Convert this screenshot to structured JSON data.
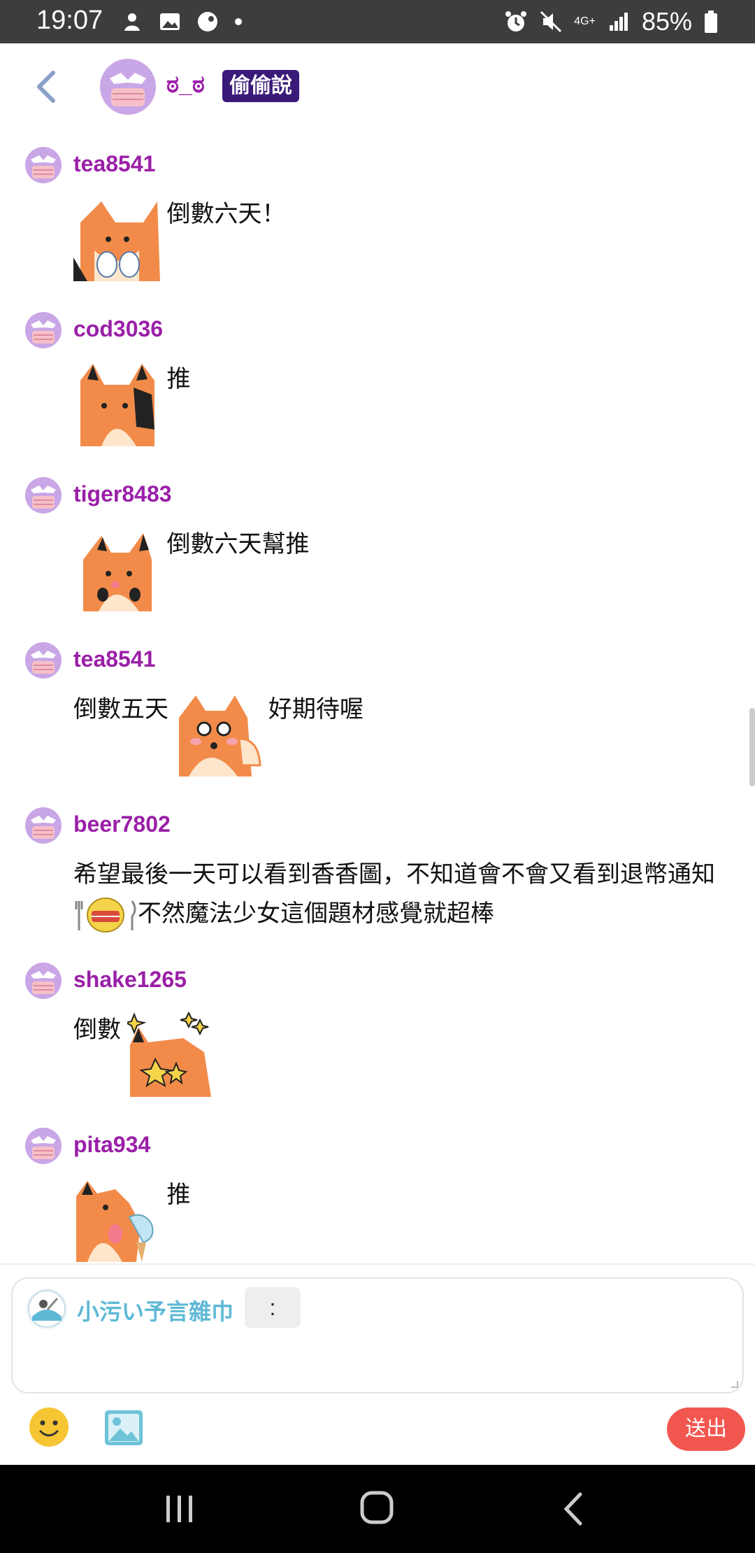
{
  "status_bar": {
    "time": "19:07",
    "battery": "85%",
    "network": "4G+",
    "left_icons": [
      "vpn-icon",
      "gallery-icon",
      "app-icon",
      "dot-icon"
    ],
    "right_icons": [
      "alarm-icon",
      "mute-icon",
      "signal-icon",
      "battery-icon"
    ]
  },
  "header": {
    "title": "ಠ_ಠ",
    "badge": "偷偷說"
  },
  "messages": [
    {
      "user": "tea8541",
      "parts": [
        {
          "type": "sticker",
          "icon": "fox-fist-sticker"
        },
        {
          "type": "text",
          "value": "倒數六天！"
        }
      ]
    },
    {
      "user": "cod3036",
      "parts": [
        {
          "type": "sticker",
          "icon": "fox-wave-sticker"
        },
        {
          "type": "text",
          "value": "推"
        }
      ]
    },
    {
      "user": "tiger8483",
      "parts": [
        {
          "type": "sticker",
          "icon": "fox-happy-sticker"
        },
        {
          "type": "text",
          "value": "倒數六天幫推"
        }
      ]
    },
    {
      "user": "tea8541",
      "parts": [
        {
          "type": "text",
          "value": "倒數五天"
        },
        {
          "type": "sticker",
          "icon": "fox-shy-sticker"
        },
        {
          "type": "text",
          "value": "好期待喔"
        }
      ]
    },
    {
      "user": "beer7802",
      "text_before": "希望最後一天可以看到香香圖，不知道會不會又看到退幣通知",
      "emoji": "hungry-emoji",
      "text_after": "不然魔法少女這個題材感覺就超棒"
    },
    {
      "user": "shake1265",
      "parts": [
        {
          "type": "text",
          "value": "倒數"
        },
        {
          "type": "sticker",
          "icon": "fox-sparkle-sticker"
        }
      ]
    },
    {
      "user": "pita934",
      "parts": [
        {
          "type": "sticker",
          "icon": "fox-icecream-sticker"
        },
        {
          "type": "text",
          "value": "推"
        }
      ]
    }
  ],
  "composer": {
    "name": "小污い予言雜巾",
    "colon": ":",
    "placeholder": "",
    "send_label": "送出"
  },
  "colors": {
    "username": "#9a1fa8",
    "badge_bg": "#3a1a78",
    "send": "#f2574f",
    "composer_name": "#5fb9d6"
  }
}
